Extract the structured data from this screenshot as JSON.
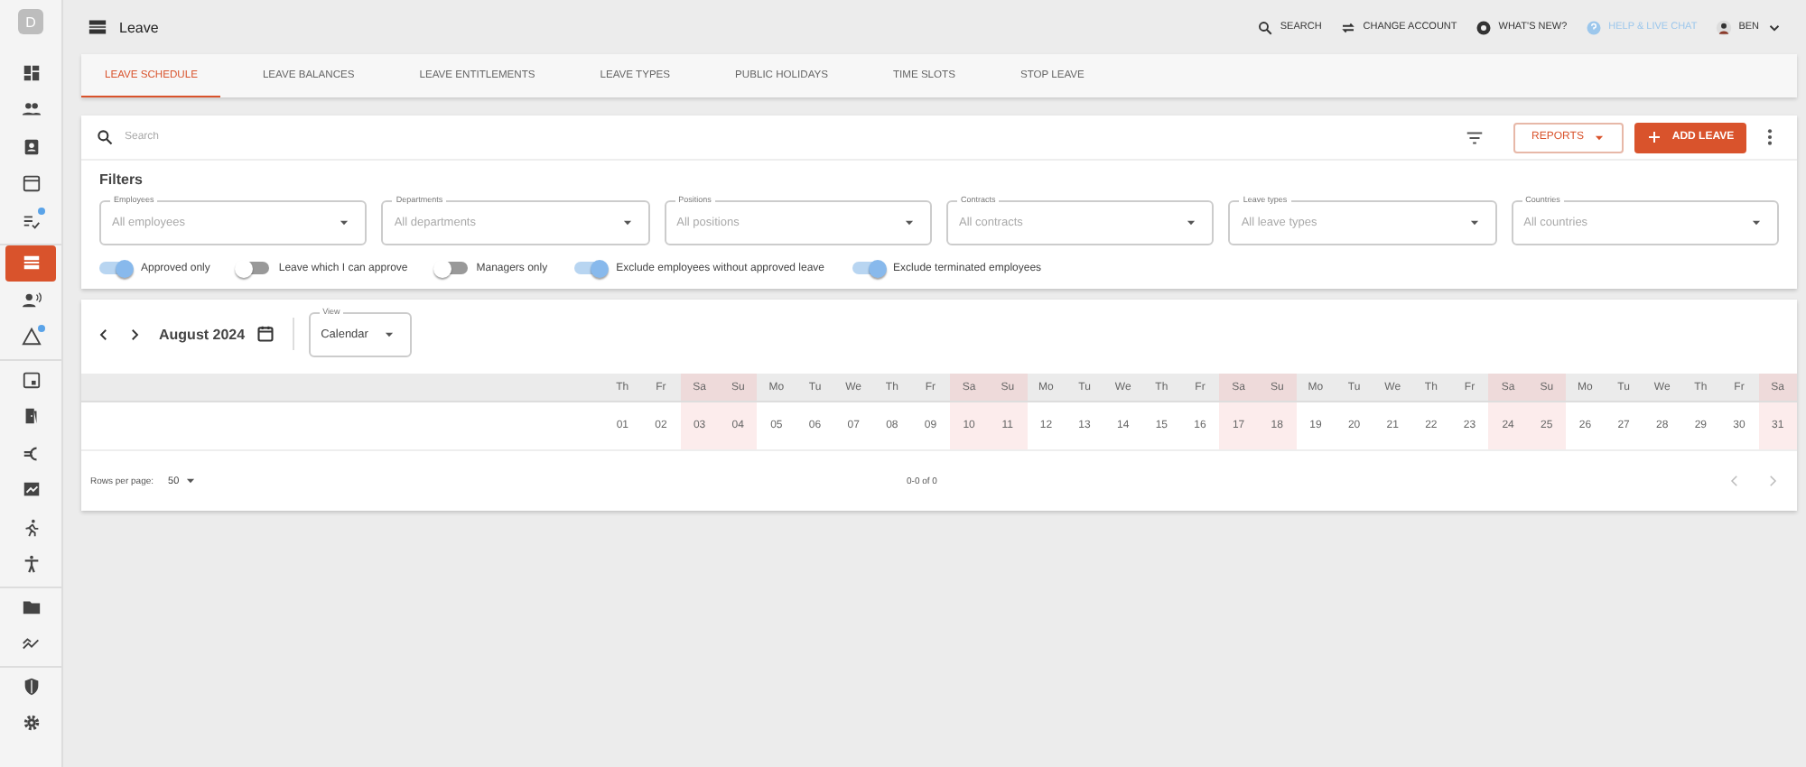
{
  "sidebar": {
    "avatar": "D",
    "groups": [
      {
        "items": [
          {
            "selected": false,
            "badge": false
          },
          {
            "selected": false,
            "badge": false
          },
          {
            "selected": false,
            "badge": false
          },
          {
            "selected": false,
            "badge": false
          },
          {
            "selected": false,
            "badge": true
          }
        ]
      },
      {
        "items": [
          {
            "selected": true,
            "badge": false
          },
          {
            "selected": false,
            "badge": false
          },
          {
            "selected": false,
            "badge": true
          }
        ]
      },
      {
        "items": [
          {
            "selected": false,
            "badge": false
          },
          {
            "selected": false,
            "badge": false
          },
          {
            "selected": false,
            "badge": false
          },
          {
            "selected": false,
            "badge": false
          },
          {
            "selected": false,
            "badge": false
          },
          {
            "selected": false,
            "badge": false
          }
        ]
      },
      {
        "items": [
          {
            "selected": false,
            "badge": false
          },
          {
            "selected": false,
            "badge": false
          }
        ]
      },
      {
        "items": [
          {
            "selected": false,
            "badge": false
          },
          {
            "selected": false,
            "badge": false
          }
        ]
      }
    ]
  },
  "header": {
    "title": "Leave",
    "links": [
      {
        "kind": "search",
        "label": "SEARCH"
      },
      {
        "kind": "switch",
        "label": "CHANGE ACCOUNT"
      },
      {
        "kind": "news",
        "label": "WHAT'S NEW?"
      },
      {
        "kind": "help",
        "label": "HELP & LIVE CHAT"
      }
    ],
    "user": "BEN"
  },
  "tabs": [
    {
      "label": "LEAVE SCHEDULE",
      "selected": true
    },
    {
      "label": "LEAVE BALANCES",
      "selected": false
    },
    {
      "label": "LEAVE ENTITLEMENTS",
      "selected": false
    },
    {
      "label": "LEAVE TYPES",
      "selected": false
    },
    {
      "label": "PUBLIC HOLIDAYS",
      "selected": false
    },
    {
      "label": "TIME SLOTS",
      "selected": false
    },
    {
      "label": "STOP LEAVE",
      "selected": false
    }
  ],
  "search": {
    "placeholder": "Search"
  },
  "buttons": {
    "reports": "REPORTS",
    "add": "ADD LEAVE"
  },
  "filters": {
    "title": "Filters",
    "fields": [
      {
        "label": "Employees",
        "placeholder": "All employees"
      },
      {
        "label": "Departments",
        "placeholder": "All departments"
      },
      {
        "label": "Positions",
        "placeholder": "All positions"
      },
      {
        "label": "Contracts",
        "placeholder": "All contracts"
      },
      {
        "label": "Leave types",
        "placeholder": "All leave types"
      },
      {
        "label": "Countries",
        "placeholder": "All countries"
      }
    ],
    "toggles": [
      {
        "label": "Approved only",
        "on": true
      },
      {
        "label": "Leave which I can approve",
        "on": false
      },
      {
        "label": "Managers only",
        "on": false
      },
      {
        "label": "Exclude employees without approved leave",
        "on": true
      },
      {
        "label": "Exclude terminated employees",
        "on": true
      }
    ]
  },
  "calendar": {
    "month": "August 2024",
    "view": {
      "label": "View",
      "value": "Calendar"
    },
    "days": [
      {
        "weekday": "Th",
        "day": "01",
        "weekend": false
      },
      {
        "weekday": "Fr",
        "day": "02",
        "weekend": false
      },
      {
        "weekday": "Sa",
        "day": "03",
        "weekend": true
      },
      {
        "weekday": "Su",
        "day": "04",
        "weekend": true
      },
      {
        "weekday": "Mo",
        "day": "05",
        "weekend": false
      },
      {
        "weekday": "Tu",
        "day": "06",
        "weekend": false
      },
      {
        "weekday": "We",
        "day": "07",
        "weekend": false
      },
      {
        "weekday": "Th",
        "day": "08",
        "weekend": false
      },
      {
        "weekday": "Fr",
        "day": "09",
        "weekend": false
      },
      {
        "weekday": "Sa",
        "day": "10",
        "weekend": true
      },
      {
        "weekday": "Su",
        "day": "11",
        "weekend": true
      },
      {
        "weekday": "Mo",
        "day": "12",
        "weekend": false
      },
      {
        "weekday": "Tu",
        "day": "13",
        "weekend": false
      },
      {
        "weekday": "We",
        "day": "14",
        "weekend": false
      },
      {
        "weekday": "Th",
        "day": "15",
        "weekend": false
      },
      {
        "weekday": "Fr",
        "day": "16",
        "weekend": false
      },
      {
        "weekday": "Sa",
        "day": "17",
        "weekend": true
      },
      {
        "weekday": "Su",
        "day": "18",
        "weekend": true
      },
      {
        "weekday": "Mo",
        "day": "19",
        "weekend": false
      },
      {
        "weekday": "Tu",
        "day": "20",
        "weekend": false
      },
      {
        "weekday": "We",
        "day": "21",
        "weekend": false
      },
      {
        "weekday": "Th",
        "day": "22",
        "weekend": false
      },
      {
        "weekday": "Fr",
        "day": "23",
        "weekend": false
      },
      {
        "weekday": "Sa",
        "day": "24",
        "weekend": true
      },
      {
        "weekday": "Su",
        "day": "25",
        "weekend": true
      },
      {
        "weekday": "Mo",
        "day": "26",
        "weekend": false
      },
      {
        "weekday": "Tu",
        "day": "27",
        "weekend": false
      },
      {
        "weekday": "We",
        "day": "28",
        "weekend": false
      },
      {
        "weekday": "Th",
        "day": "29",
        "weekend": false
      },
      {
        "weekday": "Fr",
        "day": "30",
        "weekend": false
      },
      {
        "weekday": "Sa",
        "day": "31",
        "weekend": true
      }
    ]
  },
  "pagination": {
    "rows_label": "Rows per page:",
    "rows_value": "50",
    "range": "0-0 of 0"
  }
}
